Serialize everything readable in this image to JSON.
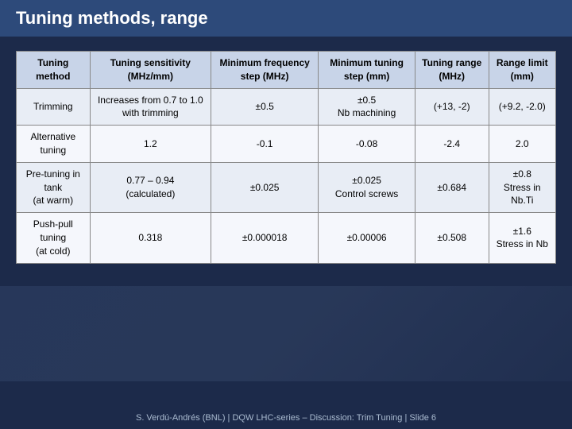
{
  "title": "Tuning methods, range",
  "table": {
    "headers": [
      "Tuning method",
      "Tuning sensitivity (MHz/mm)",
      "Minimum frequency step (MHz)",
      "Minimum tuning step (mm)",
      "Tuning range (MHz)",
      "Range limit (mm)"
    ],
    "rows": [
      {
        "method": "Trimming",
        "sensitivity": "Increases from 0.7 to 1.0 with trimming",
        "freq_step": "±0.5",
        "tuning_step": "±0.5\nNb machining",
        "tuning_range": "(+13, -2)",
        "range_limit": "(+9.2, -2.0)"
      },
      {
        "method": "Alternative tuning",
        "sensitivity": "1.2",
        "freq_step": "-0.1",
        "tuning_step": "-0.08",
        "tuning_range": "-2.4",
        "range_limit": "2.0"
      },
      {
        "method": "Pre-tuning in tank\n(at warm)",
        "sensitivity": "0.77 – 0.94\n(calculated)",
        "freq_step": "±0.025",
        "tuning_step": "±0.025\nControl screws",
        "tuning_range": "±0.684",
        "range_limit": "±0.8\nStress in Nb.Ti"
      },
      {
        "method": "Push-pull tuning\n(at cold)",
        "sensitivity": "0.318",
        "freq_step": "±0.000018",
        "tuning_step": "±0.00006",
        "tuning_range": "±0.508",
        "range_limit": "±1.6\nStress in Nb"
      }
    ]
  },
  "footer": "S. Verdú-Andrés (BNL) | DQW LHC-series – Discussion: Trim Tuning |  Slide  6"
}
